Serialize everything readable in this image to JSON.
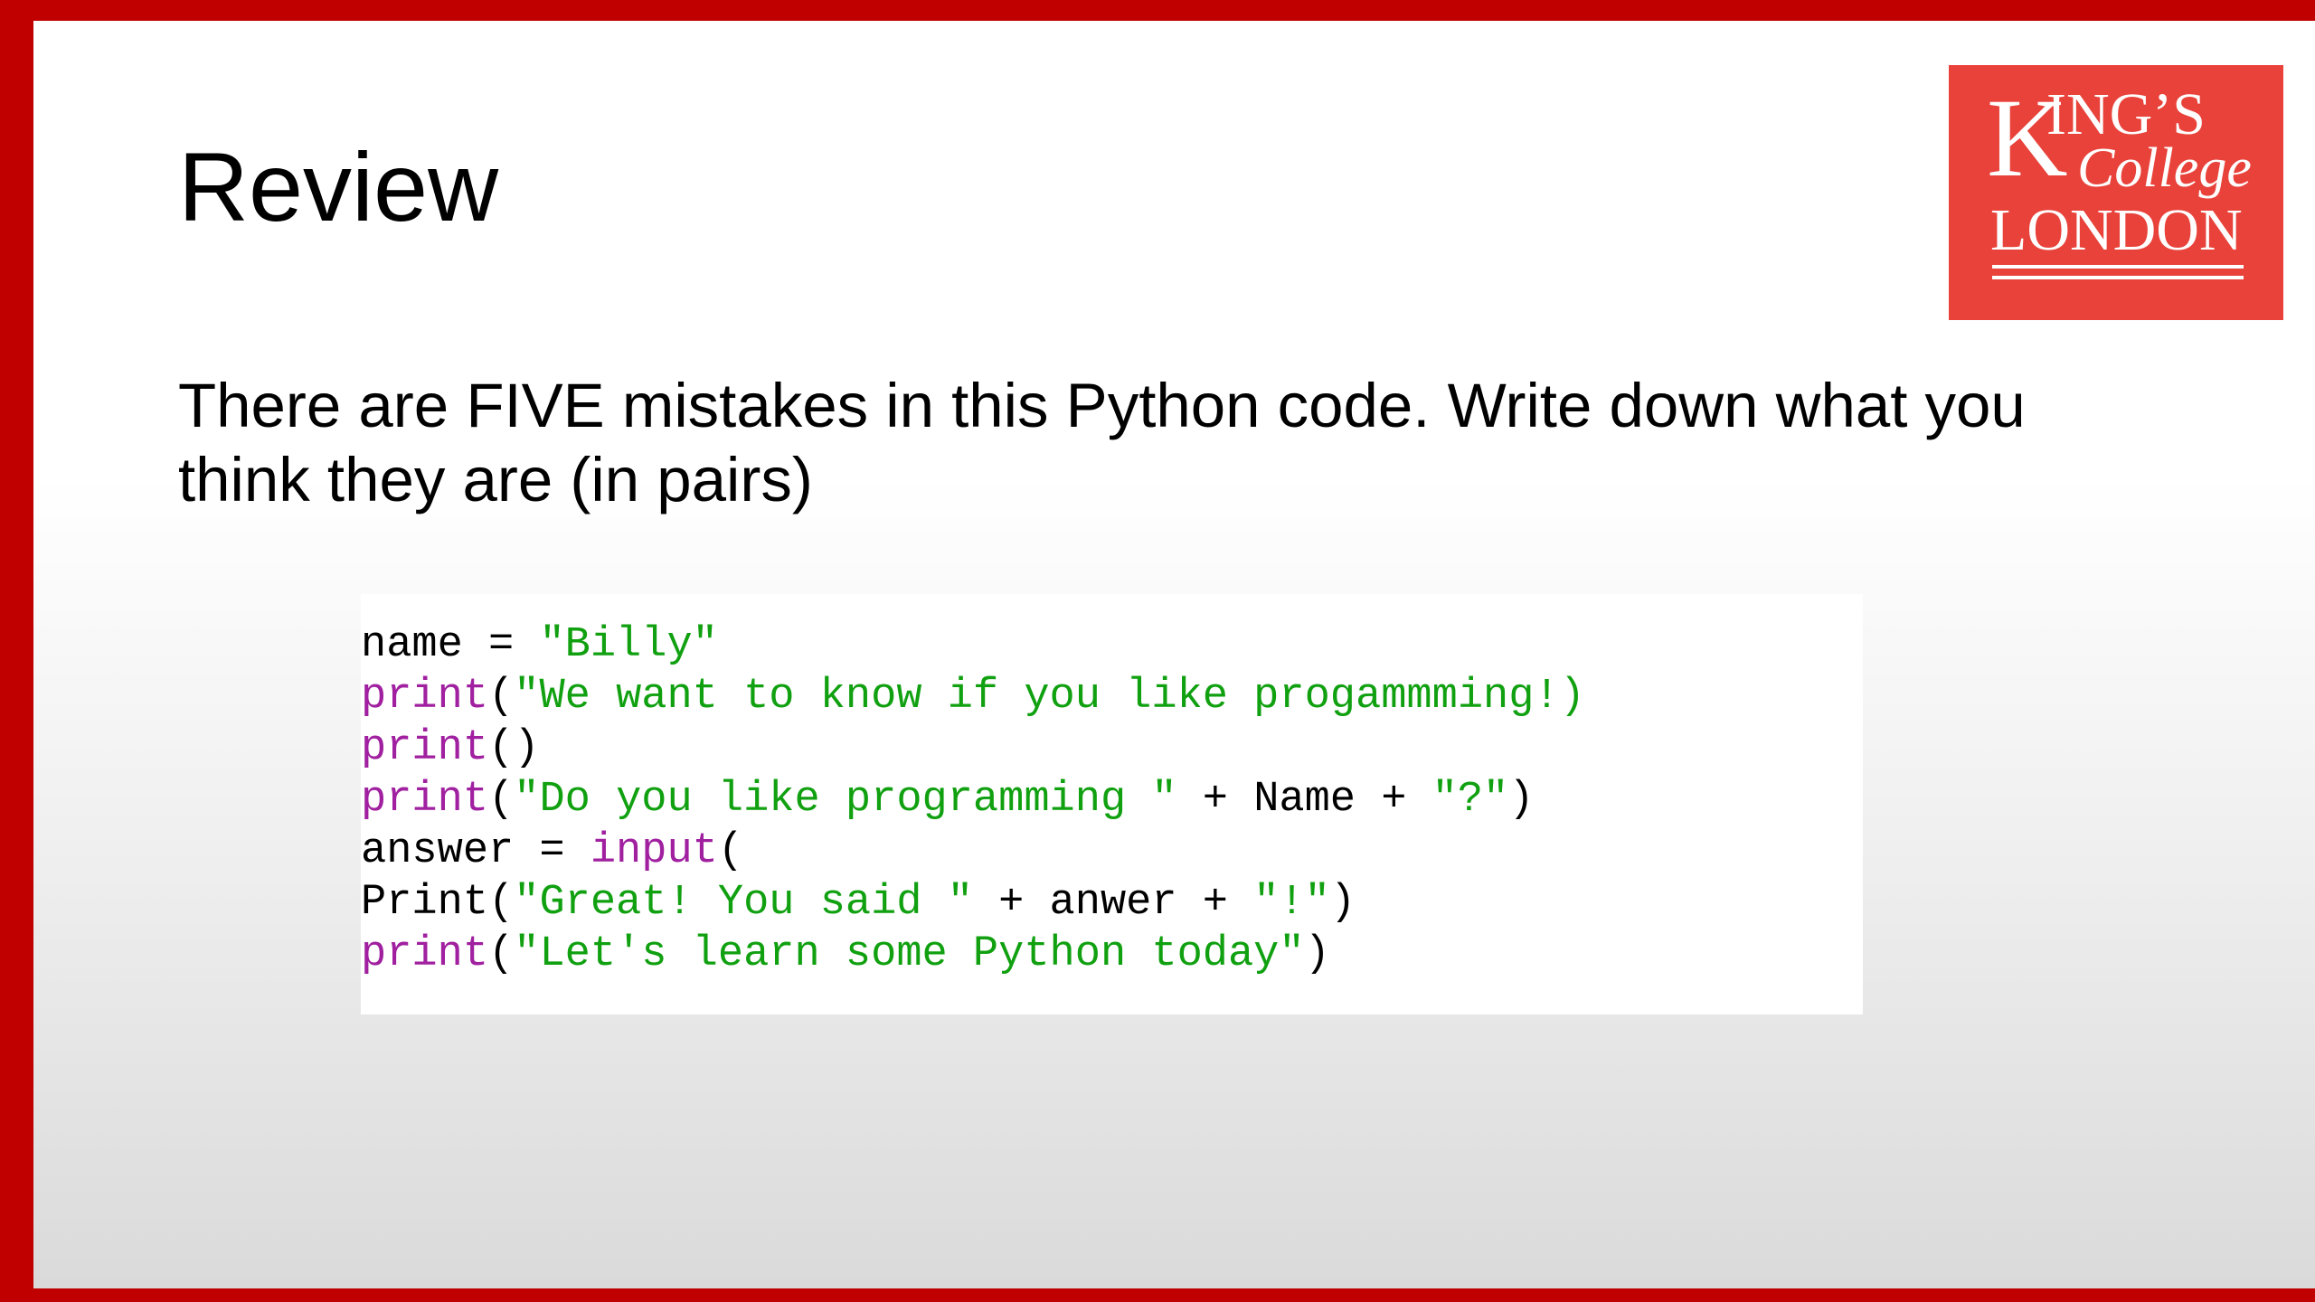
{
  "slide": {
    "title": "Review",
    "instructions": "There are FIVE mistakes in this Python code. Write down what you think they are (in pairs)"
  },
  "logo": {
    "lines": [
      "KING'S",
      "College",
      "LONDON"
    ],
    "brand_color": "#e8423a"
  },
  "colors": {
    "border": "#c00000",
    "keyword": "#a020a0",
    "string": "#10a010",
    "text": "#000000"
  },
  "code": {
    "line1": {
      "a": "name = ",
      "b": "\"Billy\""
    },
    "line2": {
      "a": "print",
      "b": "(",
      "c": "\"We want to know if you like progammming!)"
    },
    "line3": {
      "a": "print",
      "b": "()"
    },
    "line4": {
      "a": "print",
      "b": "(",
      "c": "\"Do you like programming \"",
      "d": " + Name + ",
      "e": "\"?\"",
      "f": ")"
    },
    "line5": {
      "a": "answer = ",
      "b": "input",
      "c": "("
    },
    "line6": {
      "a": "Print(",
      "b": "\"Great! You said \"",
      "c": " + anwer + ",
      "d": "\"!\"",
      "e": ")"
    },
    "line7": {
      "a": "print",
      "b": "(",
      "c": "\"Let's learn some Python today\"",
      "d": ")"
    }
  }
}
